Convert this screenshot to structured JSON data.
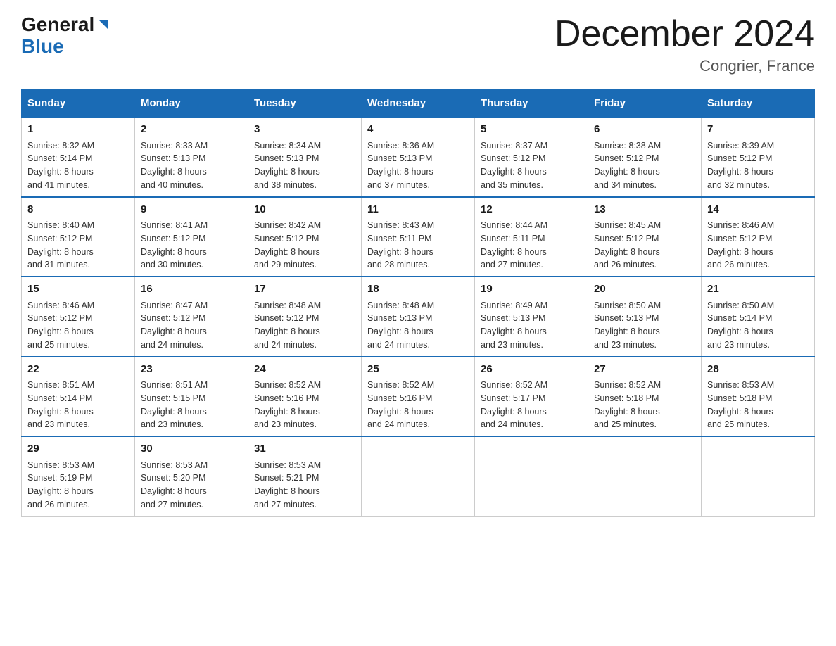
{
  "header": {
    "logo_general": "General",
    "logo_blue": "Blue",
    "title": "December 2024",
    "subtitle": "Congrier, France"
  },
  "days_of_week": [
    "Sunday",
    "Monday",
    "Tuesday",
    "Wednesday",
    "Thursday",
    "Friday",
    "Saturday"
  ],
  "weeks": [
    [
      {
        "day": "1",
        "sunrise": "Sunrise: 8:32 AM",
        "sunset": "Sunset: 5:14 PM",
        "daylight": "Daylight: 8 hours",
        "daylight2": "and 41 minutes."
      },
      {
        "day": "2",
        "sunrise": "Sunrise: 8:33 AM",
        "sunset": "Sunset: 5:13 PM",
        "daylight": "Daylight: 8 hours",
        "daylight2": "and 40 minutes."
      },
      {
        "day": "3",
        "sunrise": "Sunrise: 8:34 AM",
        "sunset": "Sunset: 5:13 PM",
        "daylight": "Daylight: 8 hours",
        "daylight2": "and 38 minutes."
      },
      {
        "day": "4",
        "sunrise": "Sunrise: 8:36 AM",
        "sunset": "Sunset: 5:13 PM",
        "daylight": "Daylight: 8 hours",
        "daylight2": "and 37 minutes."
      },
      {
        "day": "5",
        "sunrise": "Sunrise: 8:37 AM",
        "sunset": "Sunset: 5:12 PM",
        "daylight": "Daylight: 8 hours",
        "daylight2": "and 35 minutes."
      },
      {
        "day": "6",
        "sunrise": "Sunrise: 8:38 AM",
        "sunset": "Sunset: 5:12 PM",
        "daylight": "Daylight: 8 hours",
        "daylight2": "and 34 minutes."
      },
      {
        "day": "7",
        "sunrise": "Sunrise: 8:39 AM",
        "sunset": "Sunset: 5:12 PM",
        "daylight": "Daylight: 8 hours",
        "daylight2": "and 32 minutes."
      }
    ],
    [
      {
        "day": "8",
        "sunrise": "Sunrise: 8:40 AM",
        "sunset": "Sunset: 5:12 PM",
        "daylight": "Daylight: 8 hours",
        "daylight2": "and 31 minutes."
      },
      {
        "day": "9",
        "sunrise": "Sunrise: 8:41 AM",
        "sunset": "Sunset: 5:12 PM",
        "daylight": "Daylight: 8 hours",
        "daylight2": "and 30 minutes."
      },
      {
        "day": "10",
        "sunrise": "Sunrise: 8:42 AM",
        "sunset": "Sunset: 5:12 PM",
        "daylight": "Daylight: 8 hours",
        "daylight2": "and 29 minutes."
      },
      {
        "day": "11",
        "sunrise": "Sunrise: 8:43 AM",
        "sunset": "Sunset: 5:11 PM",
        "daylight": "Daylight: 8 hours",
        "daylight2": "and 28 minutes."
      },
      {
        "day": "12",
        "sunrise": "Sunrise: 8:44 AM",
        "sunset": "Sunset: 5:11 PM",
        "daylight": "Daylight: 8 hours",
        "daylight2": "and 27 minutes."
      },
      {
        "day": "13",
        "sunrise": "Sunrise: 8:45 AM",
        "sunset": "Sunset: 5:12 PM",
        "daylight": "Daylight: 8 hours",
        "daylight2": "and 26 minutes."
      },
      {
        "day": "14",
        "sunrise": "Sunrise: 8:46 AM",
        "sunset": "Sunset: 5:12 PM",
        "daylight": "Daylight: 8 hours",
        "daylight2": "and 26 minutes."
      }
    ],
    [
      {
        "day": "15",
        "sunrise": "Sunrise: 8:46 AM",
        "sunset": "Sunset: 5:12 PM",
        "daylight": "Daylight: 8 hours",
        "daylight2": "and 25 minutes."
      },
      {
        "day": "16",
        "sunrise": "Sunrise: 8:47 AM",
        "sunset": "Sunset: 5:12 PM",
        "daylight": "Daylight: 8 hours",
        "daylight2": "and 24 minutes."
      },
      {
        "day": "17",
        "sunrise": "Sunrise: 8:48 AM",
        "sunset": "Sunset: 5:12 PM",
        "daylight": "Daylight: 8 hours",
        "daylight2": "and 24 minutes."
      },
      {
        "day": "18",
        "sunrise": "Sunrise: 8:48 AM",
        "sunset": "Sunset: 5:13 PM",
        "daylight": "Daylight: 8 hours",
        "daylight2": "and 24 minutes."
      },
      {
        "day": "19",
        "sunrise": "Sunrise: 8:49 AM",
        "sunset": "Sunset: 5:13 PM",
        "daylight": "Daylight: 8 hours",
        "daylight2": "and 23 minutes."
      },
      {
        "day": "20",
        "sunrise": "Sunrise: 8:50 AM",
        "sunset": "Sunset: 5:13 PM",
        "daylight": "Daylight: 8 hours",
        "daylight2": "and 23 minutes."
      },
      {
        "day": "21",
        "sunrise": "Sunrise: 8:50 AM",
        "sunset": "Sunset: 5:14 PM",
        "daylight": "Daylight: 8 hours",
        "daylight2": "and 23 minutes."
      }
    ],
    [
      {
        "day": "22",
        "sunrise": "Sunrise: 8:51 AM",
        "sunset": "Sunset: 5:14 PM",
        "daylight": "Daylight: 8 hours",
        "daylight2": "and 23 minutes."
      },
      {
        "day": "23",
        "sunrise": "Sunrise: 8:51 AM",
        "sunset": "Sunset: 5:15 PM",
        "daylight": "Daylight: 8 hours",
        "daylight2": "and 23 minutes."
      },
      {
        "day": "24",
        "sunrise": "Sunrise: 8:52 AM",
        "sunset": "Sunset: 5:16 PM",
        "daylight": "Daylight: 8 hours",
        "daylight2": "and 23 minutes."
      },
      {
        "day": "25",
        "sunrise": "Sunrise: 8:52 AM",
        "sunset": "Sunset: 5:16 PM",
        "daylight": "Daylight: 8 hours",
        "daylight2": "and 24 minutes."
      },
      {
        "day": "26",
        "sunrise": "Sunrise: 8:52 AM",
        "sunset": "Sunset: 5:17 PM",
        "daylight": "Daylight: 8 hours",
        "daylight2": "and 24 minutes."
      },
      {
        "day": "27",
        "sunrise": "Sunrise: 8:52 AM",
        "sunset": "Sunset: 5:18 PM",
        "daylight": "Daylight: 8 hours",
        "daylight2": "and 25 minutes."
      },
      {
        "day": "28",
        "sunrise": "Sunrise: 8:53 AM",
        "sunset": "Sunset: 5:18 PM",
        "daylight": "Daylight: 8 hours",
        "daylight2": "and 25 minutes."
      }
    ],
    [
      {
        "day": "29",
        "sunrise": "Sunrise: 8:53 AM",
        "sunset": "Sunset: 5:19 PM",
        "daylight": "Daylight: 8 hours",
        "daylight2": "and 26 minutes."
      },
      {
        "day": "30",
        "sunrise": "Sunrise: 8:53 AM",
        "sunset": "Sunset: 5:20 PM",
        "daylight": "Daylight: 8 hours",
        "daylight2": "and 27 minutes."
      },
      {
        "day": "31",
        "sunrise": "Sunrise: 8:53 AM",
        "sunset": "Sunset: 5:21 PM",
        "daylight": "Daylight: 8 hours",
        "daylight2": "and 27 minutes."
      },
      null,
      null,
      null,
      null
    ]
  ]
}
